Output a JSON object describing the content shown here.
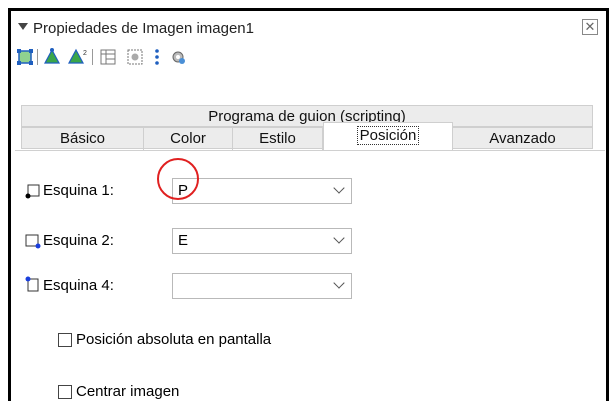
{
  "window": {
    "title": "Propiedades de Imagen imagen1",
    "close_glyph": "✕"
  },
  "toolbar": {
    "icons": [
      "select-corners-icon",
      "triangle-icon",
      "triangle-squared-icon",
      "table-icon",
      "picture-icon",
      "dots-icon",
      "gear-icon"
    ]
  },
  "tabs": {
    "row1": [
      "Programa de guion (scripting)"
    ],
    "row2": [
      "Básico",
      "Color",
      "Estilo",
      "Posición",
      "Avanzado"
    ],
    "selected": "Posición"
  },
  "corners": [
    {
      "label": "Esquina 1:",
      "value": "P"
    },
    {
      "label": "Esquina 2:",
      "value": "E"
    },
    {
      "label": "Esquina 4:",
      "value": ""
    }
  ],
  "checkboxes": [
    {
      "label": "Posición absoluta en pantalla",
      "checked": false
    },
    {
      "label": "Centrar imagen",
      "checked": false
    }
  ],
  "colors": {
    "highlight_circle": "#e02020",
    "corner_dot_black": "#000000",
    "corner_dot_blue": "#1a3fdc"
  }
}
